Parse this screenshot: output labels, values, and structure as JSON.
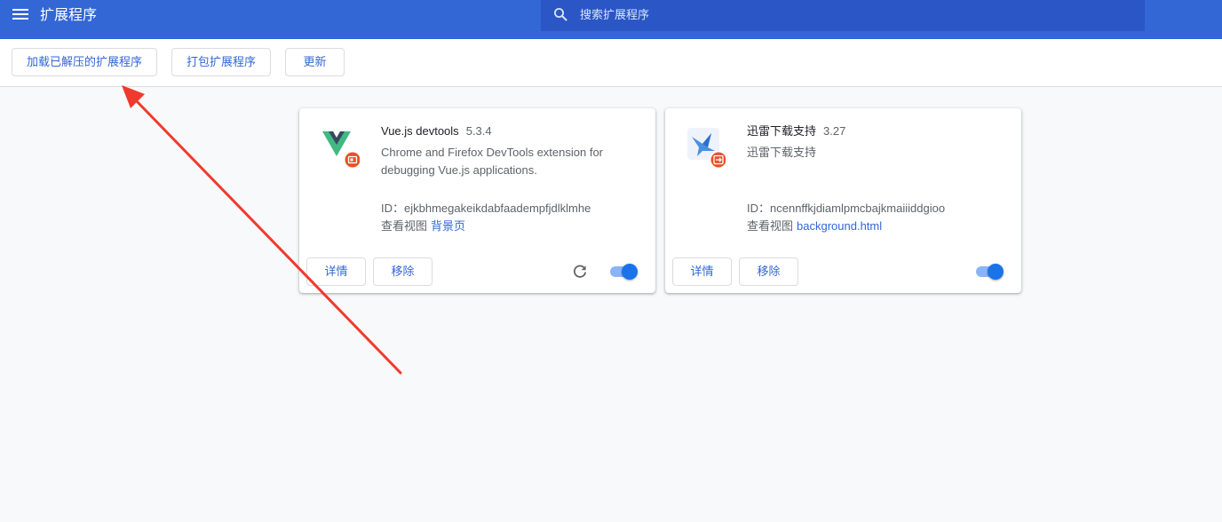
{
  "header": {
    "title": "扩展程序",
    "menu_icon": "hamburger-menu-icon",
    "search": {
      "placeholder": "搜索扩展程序",
      "value": "",
      "icon": "search-icon"
    }
  },
  "toolbar": {
    "load_unpacked_label": "加载已解压的扩展程序",
    "pack_label": "打包扩展程序",
    "update_label": "更新"
  },
  "extensions": [
    {
      "name": "Vue.js devtools",
      "version": "5.3.4",
      "description": "Chrome and Firefox DevTools extension for debugging Vue.js applications.",
      "id_label": "ID：",
      "id": "ejkbhmegakeikdabfaadempfjdlklmhe",
      "views_label": "查看视图",
      "view_link": "背景页",
      "details_label": "详情",
      "remove_label": "移除",
      "enabled": true,
      "has_reload": true,
      "icon": "vue-logo-icon",
      "badge_icon": "developer-mode-badge-icon"
    },
    {
      "name": "迅雷下载支持",
      "version": "3.27",
      "description": "迅雷下载支持",
      "id_label": "ID：",
      "id": "ncennffkjdiamlpmcbajkmaiiiddgioo",
      "views_label": "查看视图",
      "view_link": "background.html",
      "details_label": "详情",
      "remove_label": "移除",
      "enabled": true,
      "has_reload": false,
      "icon": "thunder-bird-icon",
      "badge_icon": "external-source-badge-icon"
    }
  ],
  "annotation": {
    "type": "red-arrow",
    "color": "#f03a2e"
  },
  "colors": {
    "header": "#3367d6",
    "search": "#2a56c6",
    "link": "#3367d6",
    "toggle_track": "#8ab4f8",
    "toggle_knob": "#1a73e8",
    "badge": "#e8502b"
  }
}
